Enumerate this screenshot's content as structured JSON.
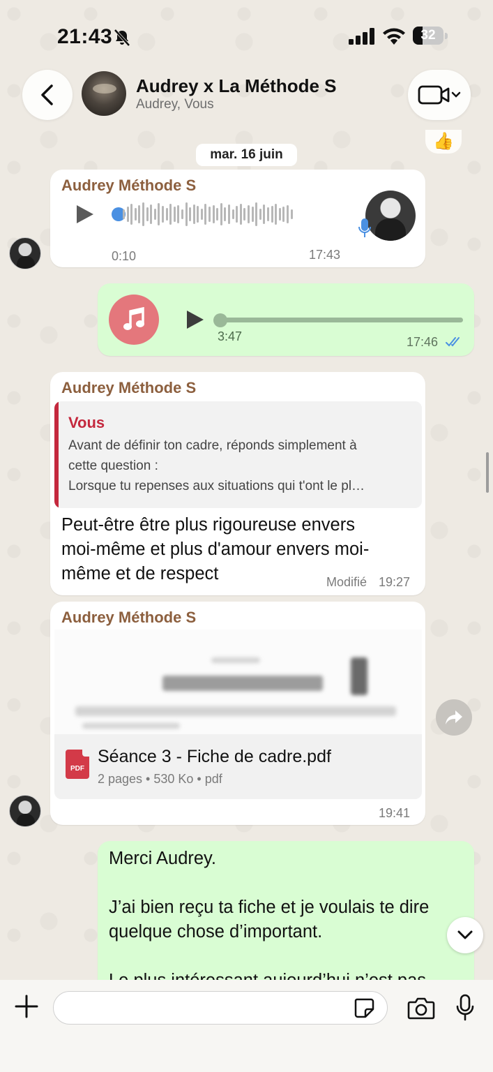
{
  "status_bar": {
    "time": "21:43",
    "battery": "32"
  },
  "header": {
    "title": "Audrey x La Méthode S",
    "subtitle": "Audrey, Vous"
  },
  "chat": {
    "date_separator": "mar. 16 juin",
    "reaction_emoji": "👍",
    "voice_message": {
      "sender": "Audrey Méthode S",
      "duration": "0:10",
      "time": "17:43"
    },
    "audio_message": {
      "duration": "3:47",
      "time": "17:46",
      "status": "read",
      "accent_color": "#4a90e2"
    },
    "reply_message": {
      "sender": "Audrey Méthode S",
      "quoted_author": "Vous",
      "quoted_line1": "Avant de définir ton cadre, réponds simplement à",
      "quoted_line2": "cette question :",
      "quoted_line3": "Lorsque tu repenses aux situations qui t'ont le pl…",
      "text_line1": "Peut-être être plus rigoureuse envers",
      "text_line2": "moi-même et plus d'amour envers moi-",
      "text_line3": "même et de respect",
      "edited_label": "Modifié",
      "time": "19:27"
    },
    "document_message": {
      "sender": "Audrey Méthode S",
      "file_name": "Séance 3 - Fiche de cadre.pdf",
      "file_info": "2 pages • 530 Ko • pdf",
      "file_icon_label": "PDF",
      "time": "19:41"
    },
    "outgoing_text": {
      "line1": "Merci Audrey.",
      "line2": "J’ai bien reçu ta fiche et je voulais te dire",
      "line3": "quelque chose d’important.",
      "line4": "Le plus intéressant aujourd’hui n’est pas"
    }
  },
  "input": {
    "placeholder": ""
  },
  "colors": {
    "sender_name": "#8c5f3e",
    "quote_accent": "#c4283d",
    "outgoing_bubble": "#d9fdd3",
    "incoming_bubble": "#ffffff",
    "music_icon_bg": "#e4777c"
  }
}
